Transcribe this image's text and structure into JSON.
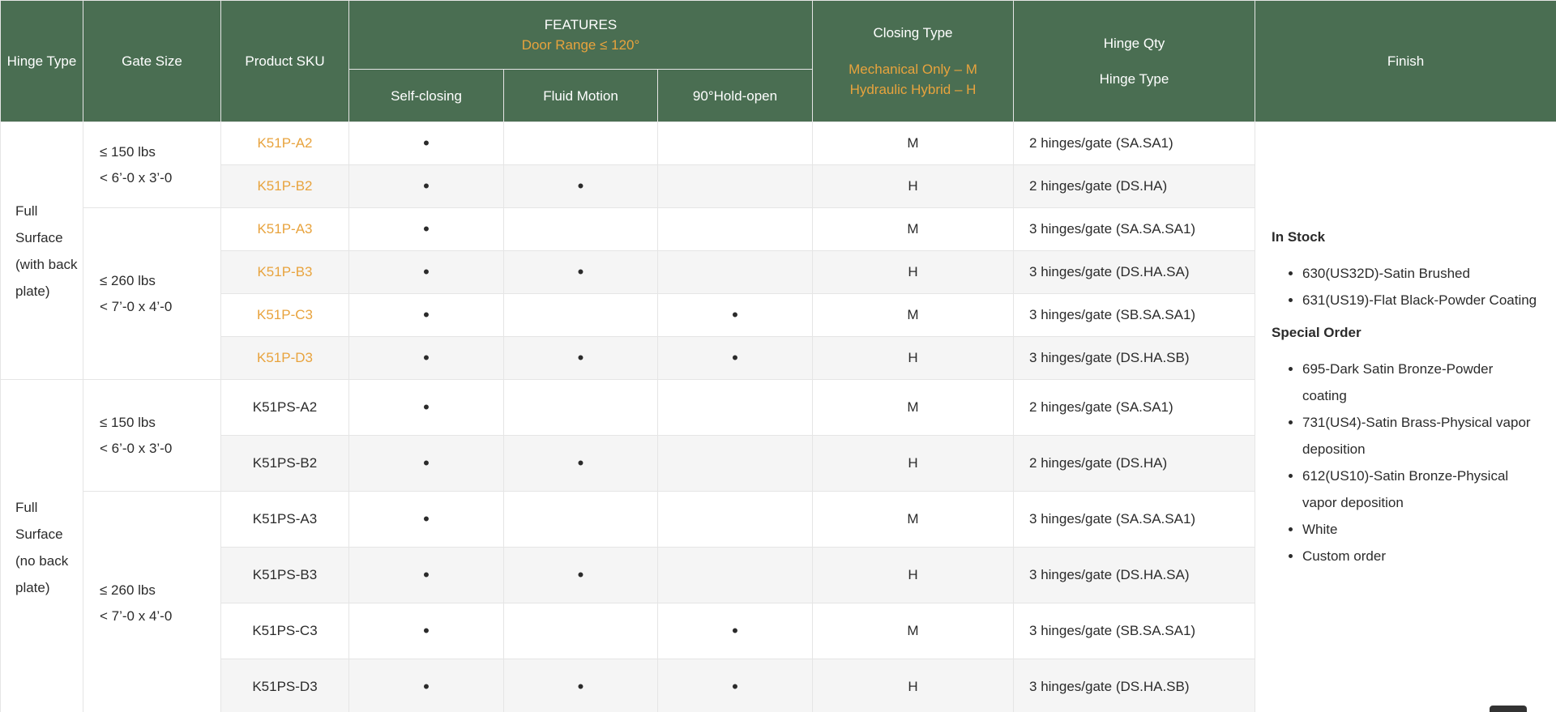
{
  "table": {
    "headers": {
      "hinge_type": "Hinge Type",
      "gate_size": "Gate Size",
      "product_sku": "Product SKU",
      "features": "FEATURES",
      "door_range": "Door Range ≤ 120°",
      "self_closing": "Self-closing",
      "fluid_motion": "Fluid Motion",
      "hold_open": "90°Hold-open",
      "closing_type": "Closing Type",
      "closing_m": "Mechanical Only – M",
      "closing_h": "Hydraulic Hybrid – H",
      "hinge_qty": "Hinge Qty",
      "hinge_type_2": "Hinge Type",
      "finish": "Finish"
    },
    "groups": [
      {
        "hinge_type": "Full Surface (with back plate)",
        "gate_sizes": [
          {
            "weight": "≤ 150 lbs",
            "dims": "< 6’-0 x 3’-0"
          },
          {
            "weight": "≤ 260 lbs",
            "dims": "< 7’-0 x 4’-0"
          }
        ]
      },
      {
        "hinge_type": "Full Surface (no back plate)",
        "gate_sizes": [
          {
            "weight": "≤ 150 lbs",
            "dims": "< 6’-0 x 3’-0"
          },
          {
            "weight": "≤ 260 lbs",
            "dims": "< 7’-0 x 4’-0"
          }
        ]
      }
    ],
    "bullet": "•",
    "rows": [
      {
        "sku": "K51P-A2",
        "self_closing": true,
        "fluid_motion": false,
        "hold_open": false,
        "closing": "M",
        "qty": "2 hinges/gate (SA.SA1)"
      },
      {
        "sku": "K51P-B2",
        "self_closing": true,
        "fluid_motion": true,
        "hold_open": false,
        "closing": "H",
        "qty": "2 hinges/gate (DS.HA)"
      },
      {
        "sku": "K51P-A3",
        "self_closing": true,
        "fluid_motion": false,
        "hold_open": false,
        "closing": "M",
        "qty": "3 hinges/gate (SA.SA.SA1)"
      },
      {
        "sku": "K51P-B3",
        "self_closing": true,
        "fluid_motion": true,
        "hold_open": false,
        "closing": "H",
        "qty": "3 hinges/gate (DS.HA.SA)"
      },
      {
        "sku": "K51P-C3",
        "self_closing": true,
        "fluid_motion": false,
        "hold_open": true,
        "closing": "M",
        "qty": "3 hinges/gate (SB.SA.SA1)"
      },
      {
        "sku": "K51P-D3",
        "self_closing": true,
        "fluid_motion": true,
        "hold_open": true,
        "closing": "H",
        "qty": "3 hinges/gate (DS.HA.SB)"
      },
      {
        "sku": "K51PS-A2",
        "self_closing": true,
        "fluid_motion": false,
        "hold_open": false,
        "closing": "M",
        "qty": "2 hinges/gate (SA.SA1)"
      },
      {
        "sku": "K51PS-B2",
        "self_closing": true,
        "fluid_motion": true,
        "hold_open": false,
        "closing": "H",
        "qty": "2 hinges/gate (DS.HA)"
      },
      {
        "sku": "K51PS-A3",
        "self_closing": true,
        "fluid_motion": false,
        "hold_open": false,
        "closing": "M",
        "qty": "3 hinges/gate (SA.SA.SA1)"
      },
      {
        "sku": "K51PS-B3",
        "self_closing": true,
        "fluid_motion": true,
        "hold_open": false,
        "closing": "H",
        "qty": "3 hinges/gate (DS.HA.SA)"
      },
      {
        "sku": "K51PS-C3",
        "self_closing": true,
        "fluid_motion": false,
        "hold_open": true,
        "closing": "M",
        "qty": "3 hinges/gate (SB.SA.SA1)"
      },
      {
        "sku": "K51PS-D3",
        "self_closing": true,
        "fluid_motion": true,
        "hold_open": true,
        "closing": "H",
        "qty": "3 hinges/gate (DS.HA.SB)"
      }
    ],
    "finish": {
      "in_stock_title": "In Stock",
      "in_stock": [
        "630(US32D)-Satin Brushed",
        "631(US19)-Flat Black-Powder Coating"
      ],
      "special_order_title": "Special Order",
      "special_order": [
        "695-Dark Satin Bronze-Powder coating",
        "731(US4)-Satin Brass-Physical vapor deposition",
        "612(US10)-Satin Bronze-Physical vapor deposition",
        "White",
        "Custom order"
      ]
    }
  },
  "colors": {
    "header_bg": "#4a6e52",
    "accent_orange": "#e8a33d",
    "row_alt_bg": "#f5f5f5",
    "border": "#e5e5e5"
  }
}
